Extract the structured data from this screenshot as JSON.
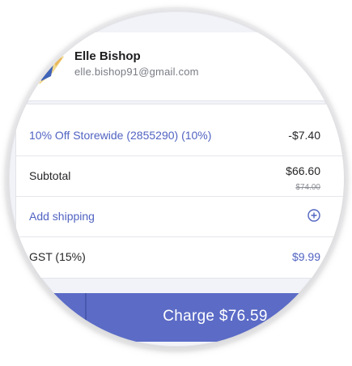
{
  "customer": {
    "name": "Elle Bishop",
    "email": "elle.bishop91@gmail.com"
  },
  "line_items": {
    "discount": {
      "label": "10% Off Storewide (2855290) (10%)",
      "value": "-$7.40"
    },
    "subtotal": {
      "label": "Subtotal",
      "value": "$66.60",
      "original_value": "$74.00"
    },
    "shipping": {
      "label": "Add shipping"
    },
    "tax": {
      "label": "GST (15%)",
      "value": "$9.99"
    }
  },
  "charge": {
    "label": "Charge $76.59"
  },
  "colors": {
    "accent": "#5163c2",
    "charge_bar": "#5b6bc6",
    "panel_bg": "#f2f3f8"
  },
  "icons": {
    "avatar": "avatar-illustration",
    "add_shipping": "plus-circle-icon"
  }
}
